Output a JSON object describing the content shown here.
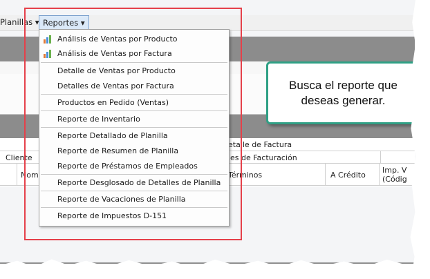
{
  "menubar": {
    "planillas_label": "Planillas ▾",
    "reportes_label": "Reportes ▾"
  },
  "menu": {
    "items": [
      {
        "label": "Análisis de Ventas por Producto",
        "icon": "bar-chart-icon"
      },
      {
        "label": "Análisis de Ventas por Factura",
        "icon": "bar-chart-icon"
      },
      {
        "label": "Detalle de Ventas por Producto"
      },
      {
        "label": "Detalles de Ventas por Factura"
      },
      {
        "label": "Productos en Pedido (Ventas)"
      },
      {
        "label": "Reporte de Inventario"
      },
      {
        "label": "Reporte Detallado de Planilla"
      },
      {
        "label": "Reporte de Resumen de Planilla"
      },
      {
        "label": "Reporte de Préstamos de Empleados"
      },
      {
        "label": "Reporte Desglosado de Detalles de Planilla"
      },
      {
        "label": "Reporte de Vacaciones de Planilla"
      },
      {
        "label": "Reporte de Impuestos D-151"
      }
    ]
  },
  "background": {
    "detalle_factura": "etalle de Factura",
    "cliente": "Cliente",
    "nombre": "Nomb",
    "facturacion": "nes de Facturación",
    "terminos": "Términos",
    "a_credito": "A Crédito",
    "imp_v": "Imp. V",
    "codig": "(Códig"
  },
  "callout": {
    "text": "Busca el reporte que deseas generar."
  },
  "colors": {
    "highlight_box": "#e5404a",
    "callout_border": "#2fa085",
    "menu_active_bg": "#dbe9f8"
  }
}
